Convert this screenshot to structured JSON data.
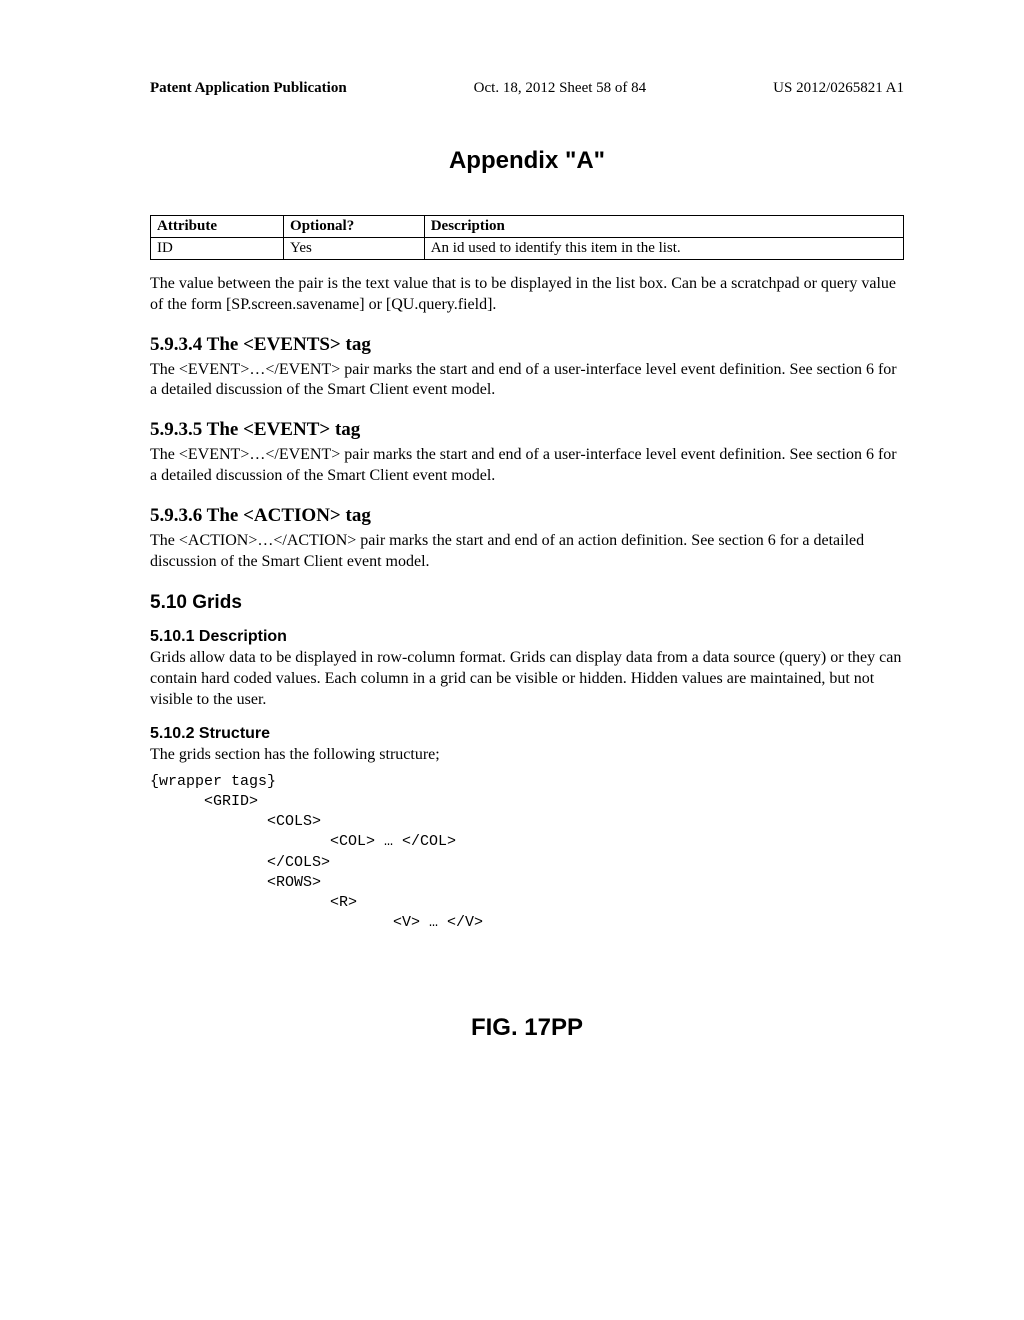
{
  "header": {
    "left": "Patent Application Publication",
    "center": "Oct. 18, 2012  Sheet 58 of 84",
    "right": "US 2012/0265821 A1"
  },
  "appendix_title": "Appendix \"A\"",
  "table": {
    "headers": [
      "Attribute",
      "Optional?",
      "Description"
    ],
    "row": [
      "ID",
      "Yes",
      "An id used to identify this item in the list."
    ]
  },
  "intro_para": "The value between the pair is the text value that is to be displayed in the list box. Can be a scratchpad or query value of the form [SP.screen.savename] or [QU.query.field].",
  "s5934": {
    "heading": "5.9.3.4  The <EVENTS> tag",
    "body": "The <EVENT>…</EVENT> pair marks the start and end of a user-interface level event definition. See section 6 for a detailed discussion of the Smart Client event model."
  },
  "s5935": {
    "heading": "5.9.3.5  The <EVENT> tag",
    "body": "The <EVENT>…</EVENT> pair marks the start and end of a user-interface level event definition. See section 6 for a detailed discussion of the Smart Client event model."
  },
  "s5936": {
    "heading": "5.9.3.6  The <ACTION> tag",
    "body": "The <ACTION>…</ACTION> pair marks the start and end of an action definition. See section 6 for a detailed discussion of the Smart Client event model."
  },
  "s510": {
    "heading": "5.10 Grids"
  },
  "s5101": {
    "heading": "5.10.1 Description",
    "body": "Grids allow data to be displayed in row-column format. Grids can display data from a data source (query) or they can contain hard coded values. Each column in a grid can be visible or hidden. Hidden values are maintained, but not visible to the user."
  },
  "s5102": {
    "heading": "5.10.2 Structure",
    "body": "The grids section has the following structure;"
  },
  "code_block": "{wrapper tags}\n      <GRID>\n             <COLS>\n                    <COL> … </COL>\n             </COLS>\n             <ROWS>\n                    <R>\n                           <V> … </V>",
  "figure_label": "FIG. 17PP"
}
